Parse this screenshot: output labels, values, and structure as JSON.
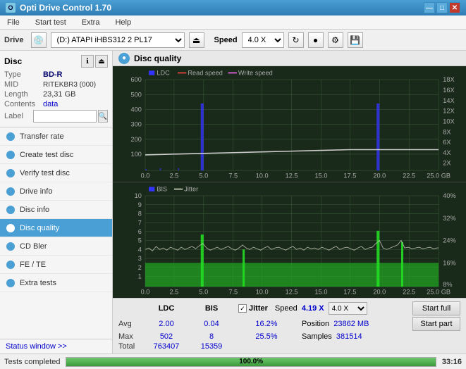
{
  "titlebar": {
    "title": "Opti Drive Control 1.70",
    "icon": "O",
    "min_btn": "—",
    "max_btn": "□",
    "close_btn": "✕"
  },
  "menubar": {
    "items": [
      "File",
      "Start test",
      "Extra",
      "Help"
    ]
  },
  "toolbar": {
    "drive_label": "Drive",
    "drive_value": "(D:) ATAPI iHBS312 2 PL17",
    "speed_label": "Speed",
    "speed_value": "4.0 X"
  },
  "disc_panel": {
    "title": "Disc",
    "rows": [
      {
        "key": "Type",
        "value": "BD-R"
      },
      {
        "key": "MID",
        "value": "RITEKBR3 (000)"
      },
      {
        "key": "Length",
        "value": "23,31 GB"
      },
      {
        "key": "Contents",
        "value": "data"
      },
      {
        "key": "Label",
        "value": ""
      }
    ]
  },
  "nav_items": [
    {
      "label": "Transfer rate",
      "id": "transfer-rate"
    },
    {
      "label": "Create test disc",
      "id": "create-test-disc"
    },
    {
      "label": "Verify test disc",
      "id": "verify-test-disc"
    },
    {
      "label": "Drive info",
      "id": "drive-info"
    },
    {
      "label": "Disc info",
      "id": "disc-info"
    },
    {
      "label": "Disc quality",
      "id": "disc-quality",
      "active": true
    },
    {
      "label": "CD Bler",
      "id": "cd-bler"
    },
    {
      "label": "FE / TE",
      "id": "fe-te"
    },
    {
      "label": "Extra tests",
      "id": "extra-tests"
    }
  ],
  "status_window_btn": "Status window >>",
  "disc_quality": {
    "title": "Disc quality",
    "legend": {
      "ldc": "LDC",
      "read": "Read speed",
      "write": "Write speed",
      "bis": "BIS",
      "jitter": "Jitter"
    }
  },
  "chart_upper": {
    "y_max": 600,
    "y_labels_left": [
      "600",
      "500",
      "400",
      "300",
      "200",
      "100"
    ],
    "y_labels_right": [
      "18X",
      "16X",
      "14X",
      "12X",
      "10X",
      "8X",
      "6X",
      "4X",
      "2X"
    ],
    "x_labels": [
      "0.0",
      "2.5",
      "5.0",
      "7.5",
      "10.0",
      "12.5",
      "15.0",
      "17.5",
      "20.0",
      "22.5",
      "25.0 GB"
    ]
  },
  "chart_lower": {
    "y_labels_left": [
      "10",
      "9",
      "8",
      "7",
      "6",
      "5",
      "4",
      "3",
      "2",
      "1"
    ],
    "y_labels_right": [
      "40%",
      "32%",
      "24%",
      "16%",
      "8%"
    ],
    "x_labels": [
      "0.0",
      "2.5",
      "5.0",
      "7.5",
      "10.0",
      "12.5",
      "15.0",
      "17.5",
      "20.0",
      "22.5",
      "25.0 GB"
    ]
  },
  "stats": {
    "headers": [
      "",
      "LDC",
      "BIS",
      "",
      "Jitter",
      "Speed",
      ""
    ],
    "rows": [
      {
        "label": "Avg",
        "ldc": "2.00",
        "bis": "0.04",
        "jitter": "16.2%"
      },
      {
        "label": "Max",
        "ldc": "502",
        "bis": "8",
        "jitter": "25.5%"
      },
      {
        "label": "Total",
        "ldc": "763407",
        "bis": "15359",
        "jitter": ""
      }
    ],
    "speed_val": "4.19 X",
    "speed_select": "4.0 X",
    "position_label": "Position",
    "position_val": "23862 MB",
    "samples_label": "Samples",
    "samples_val": "381514",
    "jitter_checked": true,
    "jitter_label": "Jitter"
  },
  "buttons": {
    "start_full": "Start full",
    "start_part": "Start part"
  },
  "statusbar": {
    "text": "Tests completed",
    "progress": 100.0,
    "progress_text": "100.0%",
    "time": "33:16"
  }
}
